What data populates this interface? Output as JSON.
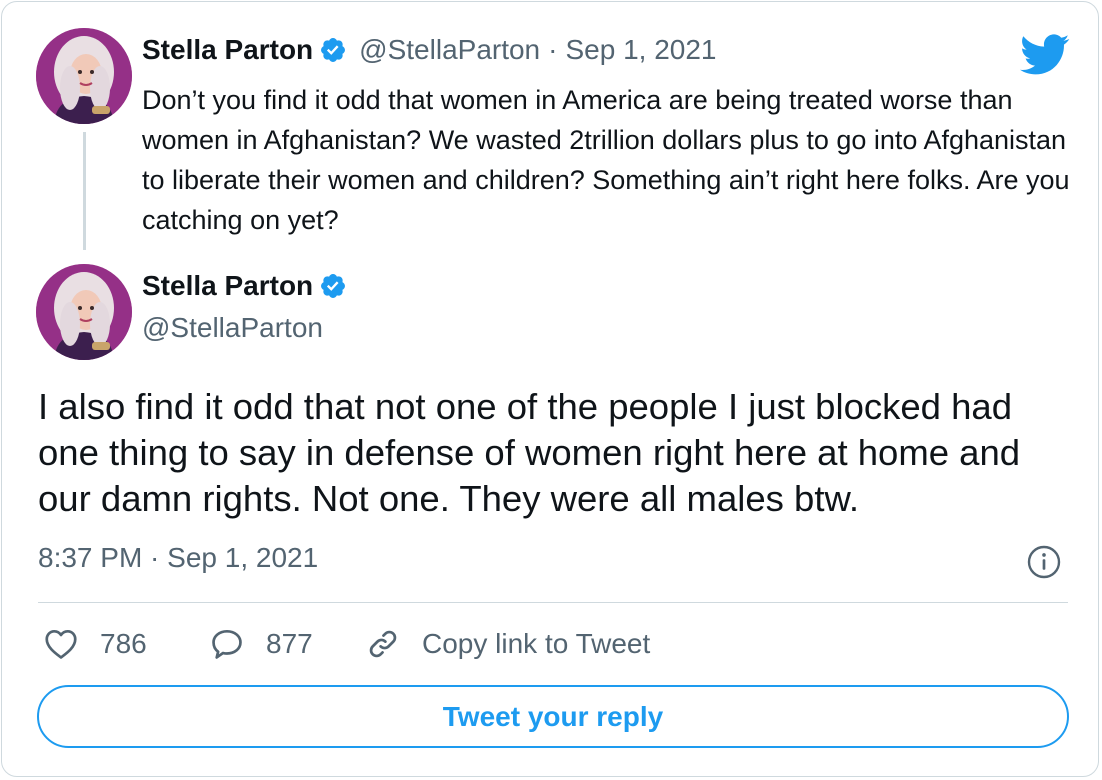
{
  "colors": {
    "accent": "#1d9bf0",
    "secondary_text": "#536471",
    "border": "#cfd9de",
    "text": "#0f1419"
  },
  "quoted_tweet": {
    "author_name": "Stella Parton",
    "verified": true,
    "handle": "@StellaParton",
    "separator": "·",
    "date": "Sep 1, 2021",
    "text": "Don’t you find it odd that women in America are being treated worse than women in Afghanistan?  We wasted 2trillion dollars plus to go into Afghanistan to liberate their women and children? Something ain’t right here folks. Are you catching on yet?"
  },
  "tweet": {
    "author_name": "Stella Parton",
    "verified": true,
    "handle": "@StellaParton",
    "text": "I also find it odd that not one of the people I just blocked had one thing to say in defense of women right here at home and our damn rights. Not one. They were all males btw.",
    "timestamp": "8:37 PM · Sep 1, 2021"
  },
  "actions": {
    "likes": "786",
    "replies": "877",
    "copy_link_label": "Copy link to Tweet"
  },
  "reply_button_label": "Tweet your reply",
  "icons": [
    "twitter-logo-icon",
    "verified-badge-icon",
    "info-icon",
    "heart-icon",
    "reply-bubble-icon",
    "link-icon"
  ]
}
